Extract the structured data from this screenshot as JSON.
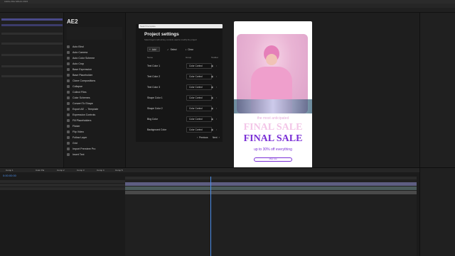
{
  "app": {
    "title": "Adobe After Effects 2024"
  },
  "plugin": {
    "logo": "AE2",
    "items": [
      {
        "label": "Auto Bind"
      },
      {
        "label": "Auto Camera"
      },
      {
        "label": "Auto Color Scheme"
      },
      {
        "label": "Auto Crop"
      },
      {
        "label": "Base Expression"
      },
      {
        "label": "Base Placeholder"
      },
      {
        "label": "Clone Compositions"
      },
      {
        "label": "Collapse"
      },
      {
        "label": "Collect Files"
      },
      {
        "label": "Color Schemes"
      },
      {
        "label": "Convert To Shape"
      },
      {
        "label": "Export AE → Template"
      },
      {
        "label": "Expression Controls"
      },
      {
        "label": "Fill Placeholders"
      },
      {
        "label": "Flicker"
      },
      {
        "label": "Flip Video"
      },
      {
        "label": "Follow Layer"
      },
      {
        "label": "Grid"
      },
      {
        "label": "Import Premiere Pro"
      },
      {
        "label": "Insert Text"
      }
    ]
  },
  "settings": {
    "title": "Project settings",
    "subtitle": "Select layers with all key controls used to modify the project",
    "search_placeholder": "Search template",
    "buttons": {
      "add": "Add",
      "select": "Select",
      "clear": "Clear",
      "previous": "Previous",
      "next": "Next"
    },
    "columns": {
      "name": "Name",
      "group": "Group",
      "toolbar": "Toolbar"
    },
    "rows": [
      {
        "name": "Text Color 1",
        "group": "Color Control"
      },
      {
        "name": "Text Color 2",
        "group": "Color Control"
      },
      {
        "name": "Text Color 3",
        "group": "Color Control"
      },
      {
        "name": "Shape Color 1",
        "group": "Color Control"
      },
      {
        "name": "Shape Color 2",
        "group": "Color Control"
      },
      {
        "name": "Bkg Color",
        "group": "Color Control"
      },
      {
        "name": "Background Color",
        "group": "Color Control"
      }
    ]
  },
  "poster": {
    "tagline": "the most anticipated",
    "title1": "FINAL SALE",
    "title2": "FINAL SALE",
    "offer": "up to 30% off everything",
    "cta": "shop now",
    "colors": {
      "bg": "#ffffff",
      "pink": "#e8aedb",
      "purple": "#7a2fd6",
      "title_light": "#f3c6e8"
    }
  },
  "timeline": {
    "timecode": "0:00:00:00",
    "tabs": [
      "Comp 1",
      "Color Pal",
      "Comp 2",
      "Comp 3",
      "Comp 4",
      "Comp 5"
    ]
  },
  "colors": {
    "accent": "#2d8ceb",
    "playhead": "#4b8eea",
    "bg": "#1d1d1d"
  }
}
